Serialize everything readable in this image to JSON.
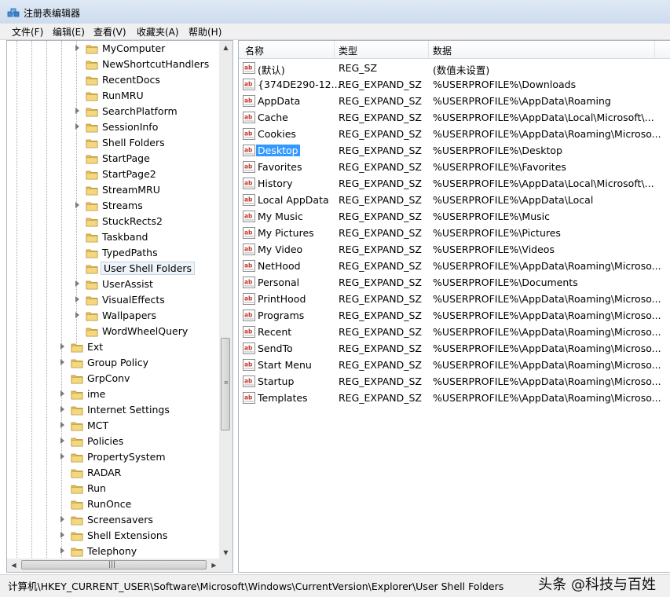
{
  "window": {
    "title": "注册表编辑器"
  },
  "menu": [
    {
      "label": "文件(F)"
    },
    {
      "label": "编辑(E)"
    },
    {
      "label": "查看(V)"
    },
    {
      "label": "收藏夹(A)"
    },
    {
      "label": "帮助(H)"
    }
  ],
  "tree": {
    "selected": "User Shell Folders",
    "items": [
      {
        "label": "MyComputer",
        "level": 2,
        "expandable": true
      },
      {
        "label": "NewShortcutHandlers",
        "level": 2,
        "expandable": false
      },
      {
        "label": "RecentDocs",
        "level": 2,
        "expandable": false
      },
      {
        "label": "RunMRU",
        "level": 2,
        "expandable": false
      },
      {
        "label": "SearchPlatform",
        "level": 2,
        "expandable": true
      },
      {
        "label": "SessionInfo",
        "level": 2,
        "expandable": true
      },
      {
        "label": "Shell Folders",
        "level": 2,
        "expandable": false
      },
      {
        "label": "StartPage",
        "level": 2,
        "expandable": false
      },
      {
        "label": "StartPage2",
        "level": 2,
        "expandable": false
      },
      {
        "label": "StreamMRU",
        "level": 2,
        "expandable": false
      },
      {
        "label": "Streams",
        "level": 2,
        "expandable": true
      },
      {
        "label": "StuckRects2",
        "level": 2,
        "expandable": false
      },
      {
        "label": "Taskband",
        "level": 2,
        "expandable": false
      },
      {
        "label": "TypedPaths",
        "level": 2,
        "expandable": false
      },
      {
        "label": "User Shell Folders",
        "level": 2,
        "expandable": false
      },
      {
        "label": "UserAssist",
        "level": 2,
        "expandable": true
      },
      {
        "label": "VisualEffects",
        "level": 2,
        "expandable": true
      },
      {
        "label": "Wallpapers",
        "level": 2,
        "expandable": true
      },
      {
        "label": "WordWheelQuery",
        "level": 2,
        "expandable": false
      },
      {
        "label": "Ext",
        "level": 1,
        "expandable": true
      },
      {
        "label": "Group Policy",
        "level": 1,
        "expandable": true
      },
      {
        "label": "GrpConv",
        "level": 1,
        "expandable": false
      },
      {
        "label": "ime",
        "level": 1,
        "expandable": true
      },
      {
        "label": "Internet Settings",
        "level": 1,
        "expandable": true
      },
      {
        "label": "MCT",
        "level": 1,
        "expandable": true
      },
      {
        "label": "Policies",
        "level": 1,
        "expandable": true
      },
      {
        "label": "PropertySystem",
        "level": 1,
        "expandable": true
      },
      {
        "label": "RADAR",
        "level": 1,
        "expandable": false
      },
      {
        "label": "Run",
        "level": 1,
        "expandable": false
      },
      {
        "label": "RunOnce",
        "level": 1,
        "expandable": false
      },
      {
        "label": "Screensavers",
        "level": 1,
        "expandable": true
      },
      {
        "label": "Shell Extensions",
        "level": 1,
        "expandable": true
      },
      {
        "label": "Telephony",
        "level": 1,
        "expandable": true
      }
    ]
  },
  "list": {
    "columns": {
      "name": "名称",
      "type": "类型",
      "data": "数据"
    },
    "selected": "Desktop",
    "rows": [
      {
        "name": "(默认)",
        "type": "REG_SZ",
        "data": "(数值未设置)"
      },
      {
        "name": "{374DE290-12...",
        "type": "REG_EXPAND_SZ",
        "data": "%USERPROFILE%\\Downloads"
      },
      {
        "name": "AppData",
        "type": "REG_EXPAND_SZ",
        "data": "%USERPROFILE%\\AppData\\Roaming"
      },
      {
        "name": "Cache",
        "type": "REG_EXPAND_SZ",
        "data": "%USERPROFILE%\\AppData\\Local\\Microsoft\\..."
      },
      {
        "name": "Cookies",
        "type": "REG_EXPAND_SZ",
        "data": "%USERPROFILE%\\AppData\\Roaming\\Microso..."
      },
      {
        "name": "Desktop",
        "type": "REG_EXPAND_SZ",
        "data": "%USERPROFILE%\\Desktop"
      },
      {
        "name": "Favorites",
        "type": "REG_EXPAND_SZ",
        "data": "%USERPROFILE%\\Favorites"
      },
      {
        "name": "History",
        "type": "REG_EXPAND_SZ",
        "data": "%USERPROFILE%\\AppData\\Local\\Microsoft\\..."
      },
      {
        "name": "Local AppData",
        "type": "REG_EXPAND_SZ",
        "data": "%USERPROFILE%\\AppData\\Local"
      },
      {
        "name": "My Music",
        "type": "REG_EXPAND_SZ",
        "data": "%USERPROFILE%\\Music"
      },
      {
        "name": "My Pictures",
        "type": "REG_EXPAND_SZ",
        "data": "%USERPROFILE%\\Pictures"
      },
      {
        "name": "My Video",
        "type": "REG_EXPAND_SZ",
        "data": "%USERPROFILE%\\Videos"
      },
      {
        "name": "NetHood",
        "type": "REG_EXPAND_SZ",
        "data": "%USERPROFILE%\\AppData\\Roaming\\Microso..."
      },
      {
        "name": "Personal",
        "type": "REG_EXPAND_SZ",
        "data": "%USERPROFILE%\\Documents"
      },
      {
        "name": "PrintHood",
        "type": "REG_EXPAND_SZ",
        "data": "%USERPROFILE%\\AppData\\Roaming\\Microso..."
      },
      {
        "name": "Programs",
        "type": "REG_EXPAND_SZ",
        "data": "%USERPROFILE%\\AppData\\Roaming\\Microso..."
      },
      {
        "name": "Recent",
        "type": "REG_EXPAND_SZ",
        "data": "%USERPROFILE%\\AppData\\Roaming\\Microso..."
      },
      {
        "name": "SendTo",
        "type": "REG_EXPAND_SZ",
        "data": "%USERPROFILE%\\AppData\\Roaming\\Microso..."
      },
      {
        "name": "Start Menu",
        "type": "REG_EXPAND_SZ",
        "data": "%USERPROFILE%\\AppData\\Roaming\\Microso..."
      },
      {
        "name": "Startup",
        "type": "REG_EXPAND_SZ",
        "data": "%USERPROFILE%\\AppData\\Roaming\\Microso..."
      },
      {
        "name": "Templates",
        "type": "REG_EXPAND_SZ",
        "data": "%USERPROFILE%\\AppData\\Roaming\\Microso..."
      }
    ]
  },
  "status": {
    "path": "计算机\\HKEY_CURRENT_USER\\Software\\Microsoft\\Windows\\CurrentVersion\\Explorer\\User Shell Folders",
    "watermark": "头条 @科技与百姓"
  },
  "colors": {
    "folder": "#e8c25a",
    "selection": "#3399ff",
    "ab_red": "#c0392b"
  },
  "icons": {
    "app": "registry-icon",
    "folder": "folder-icon",
    "string_value": "ab-string-icon"
  }
}
